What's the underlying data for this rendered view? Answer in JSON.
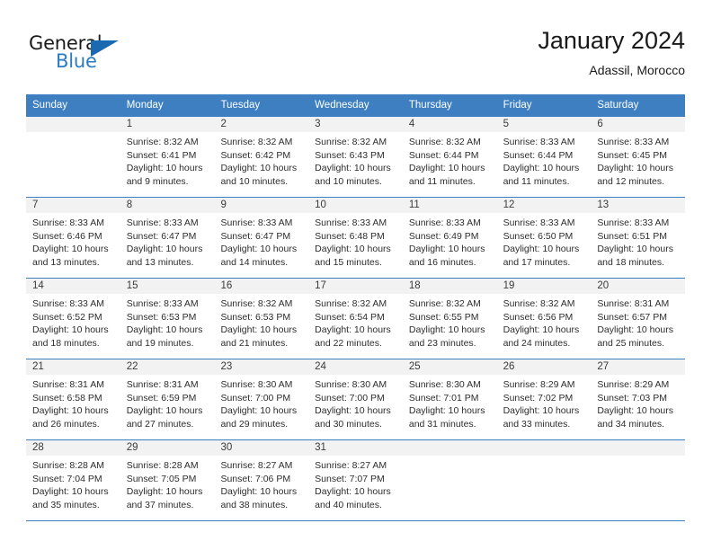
{
  "brand": {
    "word_one": "General",
    "word_two": "Blue",
    "triangle_icon": "triangle-icon",
    "accent_color": "#2b7cc1",
    "triangle_color": "#1b69b0"
  },
  "header": {
    "title": "January 2024",
    "subtitle": "Adassil, Morocco"
  },
  "calendar": {
    "header_color": "#3d7fc1",
    "daynum_bg": "#f2f2f2",
    "weekdays": [
      "Sunday",
      "Monday",
      "Tuesday",
      "Wednesday",
      "Thursday",
      "Friday",
      "Saturday"
    ],
    "weeks": [
      [
        {
          "day": "",
          "sunrise": "",
          "sunset": "",
          "daylight1": "",
          "daylight2": ""
        },
        {
          "day": "1",
          "sunrise": "Sunrise: 8:32 AM",
          "sunset": "Sunset: 6:41 PM",
          "daylight1": "Daylight: 10 hours",
          "daylight2": "and 9 minutes."
        },
        {
          "day": "2",
          "sunrise": "Sunrise: 8:32 AM",
          "sunset": "Sunset: 6:42 PM",
          "daylight1": "Daylight: 10 hours",
          "daylight2": "and 10 minutes."
        },
        {
          "day": "3",
          "sunrise": "Sunrise: 8:32 AM",
          "sunset": "Sunset: 6:43 PM",
          "daylight1": "Daylight: 10 hours",
          "daylight2": "and 10 minutes."
        },
        {
          "day": "4",
          "sunrise": "Sunrise: 8:32 AM",
          "sunset": "Sunset: 6:44 PM",
          "daylight1": "Daylight: 10 hours",
          "daylight2": "and 11 minutes."
        },
        {
          "day": "5",
          "sunrise": "Sunrise: 8:33 AM",
          "sunset": "Sunset: 6:44 PM",
          "daylight1": "Daylight: 10 hours",
          "daylight2": "and 11 minutes."
        },
        {
          "day": "6",
          "sunrise": "Sunrise: 8:33 AM",
          "sunset": "Sunset: 6:45 PM",
          "daylight1": "Daylight: 10 hours",
          "daylight2": "and 12 minutes."
        }
      ],
      [
        {
          "day": "7",
          "sunrise": "Sunrise: 8:33 AM",
          "sunset": "Sunset: 6:46 PM",
          "daylight1": "Daylight: 10 hours",
          "daylight2": "and 13 minutes."
        },
        {
          "day": "8",
          "sunrise": "Sunrise: 8:33 AM",
          "sunset": "Sunset: 6:47 PM",
          "daylight1": "Daylight: 10 hours",
          "daylight2": "and 13 minutes."
        },
        {
          "day": "9",
          "sunrise": "Sunrise: 8:33 AM",
          "sunset": "Sunset: 6:47 PM",
          "daylight1": "Daylight: 10 hours",
          "daylight2": "and 14 minutes."
        },
        {
          "day": "10",
          "sunrise": "Sunrise: 8:33 AM",
          "sunset": "Sunset: 6:48 PM",
          "daylight1": "Daylight: 10 hours",
          "daylight2": "and 15 minutes."
        },
        {
          "day": "11",
          "sunrise": "Sunrise: 8:33 AM",
          "sunset": "Sunset: 6:49 PM",
          "daylight1": "Daylight: 10 hours",
          "daylight2": "and 16 minutes."
        },
        {
          "day": "12",
          "sunrise": "Sunrise: 8:33 AM",
          "sunset": "Sunset: 6:50 PM",
          "daylight1": "Daylight: 10 hours",
          "daylight2": "and 17 minutes."
        },
        {
          "day": "13",
          "sunrise": "Sunrise: 8:33 AM",
          "sunset": "Sunset: 6:51 PM",
          "daylight1": "Daylight: 10 hours",
          "daylight2": "and 18 minutes."
        }
      ],
      [
        {
          "day": "14",
          "sunrise": "Sunrise: 8:33 AM",
          "sunset": "Sunset: 6:52 PM",
          "daylight1": "Daylight: 10 hours",
          "daylight2": "and 18 minutes."
        },
        {
          "day": "15",
          "sunrise": "Sunrise: 8:33 AM",
          "sunset": "Sunset: 6:53 PM",
          "daylight1": "Daylight: 10 hours",
          "daylight2": "and 19 minutes."
        },
        {
          "day": "16",
          "sunrise": "Sunrise: 8:32 AM",
          "sunset": "Sunset: 6:53 PM",
          "daylight1": "Daylight: 10 hours",
          "daylight2": "and 21 minutes."
        },
        {
          "day": "17",
          "sunrise": "Sunrise: 8:32 AM",
          "sunset": "Sunset: 6:54 PM",
          "daylight1": "Daylight: 10 hours",
          "daylight2": "and 22 minutes."
        },
        {
          "day": "18",
          "sunrise": "Sunrise: 8:32 AM",
          "sunset": "Sunset: 6:55 PM",
          "daylight1": "Daylight: 10 hours",
          "daylight2": "and 23 minutes."
        },
        {
          "day": "19",
          "sunrise": "Sunrise: 8:32 AM",
          "sunset": "Sunset: 6:56 PM",
          "daylight1": "Daylight: 10 hours",
          "daylight2": "and 24 minutes."
        },
        {
          "day": "20",
          "sunrise": "Sunrise: 8:31 AM",
          "sunset": "Sunset: 6:57 PM",
          "daylight1": "Daylight: 10 hours",
          "daylight2": "and 25 minutes."
        }
      ],
      [
        {
          "day": "21",
          "sunrise": "Sunrise: 8:31 AM",
          "sunset": "Sunset: 6:58 PM",
          "daylight1": "Daylight: 10 hours",
          "daylight2": "and 26 minutes."
        },
        {
          "day": "22",
          "sunrise": "Sunrise: 8:31 AM",
          "sunset": "Sunset: 6:59 PM",
          "daylight1": "Daylight: 10 hours",
          "daylight2": "and 27 minutes."
        },
        {
          "day": "23",
          "sunrise": "Sunrise: 8:30 AM",
          "sunset": "Sunset: 7:00 PM",
          "daylight1": "Daylight: 10 hours",
          "daylight2": "and 29 minutes."
        },
        {
          "day": "24",
          "sunrise": "Sunrise: 8:30 AM",
          "sunset": "Sunset: 7:00 PM",
          "daylight1": "Daylight: 10 hours",
          "daylight2": "and 30 minutes."
        },
        {
          "day": "25",
          "sunrise": "Sunrise: 8:30 AM",
          "sunset": "Sunset: 7:01 PM",
          "daylight1": "Daylight: 10 hours",
          "daylight2": "and 31 minutes."
        },
        {
          "day": "26",
          "sunrise": "Sunrise: 8:29 AM",
          "sunset": "Sunset: 7:02 PM",
          "daylight1": "Daylight: 10 hours",
          "daylight2": "and 33 minutes."
        },
        {
          "day": "27",
          "sunrise": "Sunrise: 8:29 AM",
          "sunset": "Sunset: 7:03 PM",
          "daylight1": "Daylight: 10 hours",
          "daylight2": "and 34 minutes."
        }
      ],
      [
        {
          "day": "28",
          "sunrise": "Sunrise: 8:28 AM",
          "sunset": "Sunset: 7:04 PM",
          "daylight1": "Daylight: 10 hours",
          "daylight2": "and 35 minutes."
        },
        {
          "day": "29",
          "sunrise": "Sunrise: 8:28 AM",
          "sunset": "Sunset: 7:05 PM",
          "daylight1": "Daylight: 10 hours",
          "daylight2": "and 37 minutes."
        },
        {
          "day": "30",
          "sunrise": "Sunrise: 8:27 AM",
          "sunset": "Sunset: 7:06 PM",
          "daylight1": "Daylight: 10 hours",
          "daylight2": "and 38 minutes."
        },
        {
          "day": "31",
          "sunrise": "Sunrise: 8:27 AM",
          "sunset": "Sunset: 7:07 PM",
          "daylight1": "Daylight: 10 hours",
          "daylight2": "and 40 minutes."
        },
        {
          "day": "",
          "sunrise": "",
          "sunset": "",
          "daylight1": "",
          "daylight2": ""
        },
        {
          "day": "",
          "sunrise": "",
          "sunset": "",
          "daylight1": "",
          "daylight2": ""
        },
        {
          "day": "",
          "sunrise": "",
          "sunset": "",
          "daylight1": "",
          "daylight2": ""
        }
      ]
    ]
  }
}
